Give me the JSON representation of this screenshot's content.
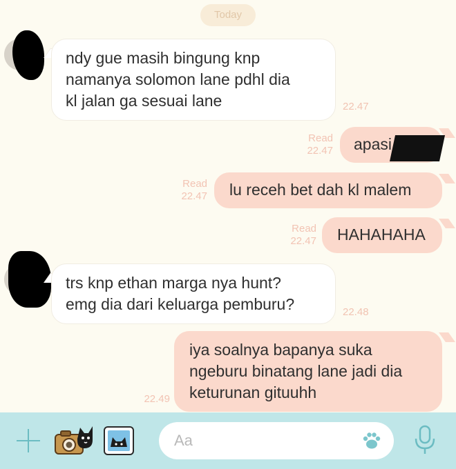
{
  "date_label": "Today",
  "messages": [
    {
      "direction": "in",
      "lines": [
        "ndy gue masih bingung knp",
        "namanya solomon lane pdhl dia",
        "kl jalan ga sesuai lane"
      ],
      "time": "22.47"
    },
    {
      "direction": "out",
      "text": "apasi",
      "read": "Read",
      "time": "22.47"
    },
    {
      "direction": "out",
      "text": "lu receh bet dah kl malem",
      "read": "Read",
      "time": "22.47"
    },
    {
      "direction": "out",
      "text": "HAHAHAHA",
      "read": "Read",
      "time": "22.47"
    },
    {
      "direction": "in",
      "lines": [
        "trs knp ethan marga nya hunt?",
        "emg dia dari keluarga pemburu?"
      ],
      "time": "22.48"
    },
    {
      "direction": "out",
      "lines": [
        "iya soalnya bapanya suka",
        "ngeburu binatang lane jadi dia",
        "keturunan gituuhh"
      ],
      "time": "22.49"
    }
  ],
  "composer": {
    "placeholder": "Aa"
  },
  "colors": {
    "background": "#fdfbf1",
    "outgoing_bubble": "#fbd9cc",
    "incoming_bubble": "#ffffff",
    "meta_text": "#f2c3b3",
    "bottom_bar": "#bfe6e8"
  },
  "icons": [
    "plus-icon",
    "camera-sticker-icon",
    "image-icon",
    "paw-icon",
    "mic-icon"
  ]
}
